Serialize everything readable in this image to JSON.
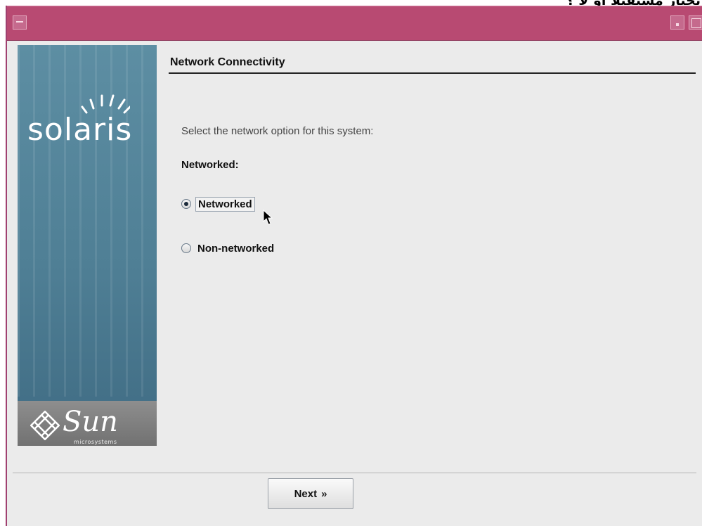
{
  "caption": "بختار مستقبلا او لا ؟",
  "window": {
    "title_color": "#b84a72"
  },
  "branding": {
    "product_name": "solaris",
    "vendor_name": "Sun",
    "vendor_sub": "microsystems"
  },
  "page": {
    "title": "Network Connectivity",
    "prompt": "Select the network option for this system:",
    "group_label": "Networked:",
    "options": [
      {
        "label": "Networked",
        "selected": true
      },
      {
        "label": "Non-networked",
        "selected": false
      }
    ]
  },
  "footer": {
    "next_label": "Next",
    "next_icon": "double-chevron-right-icon"
  }
}
